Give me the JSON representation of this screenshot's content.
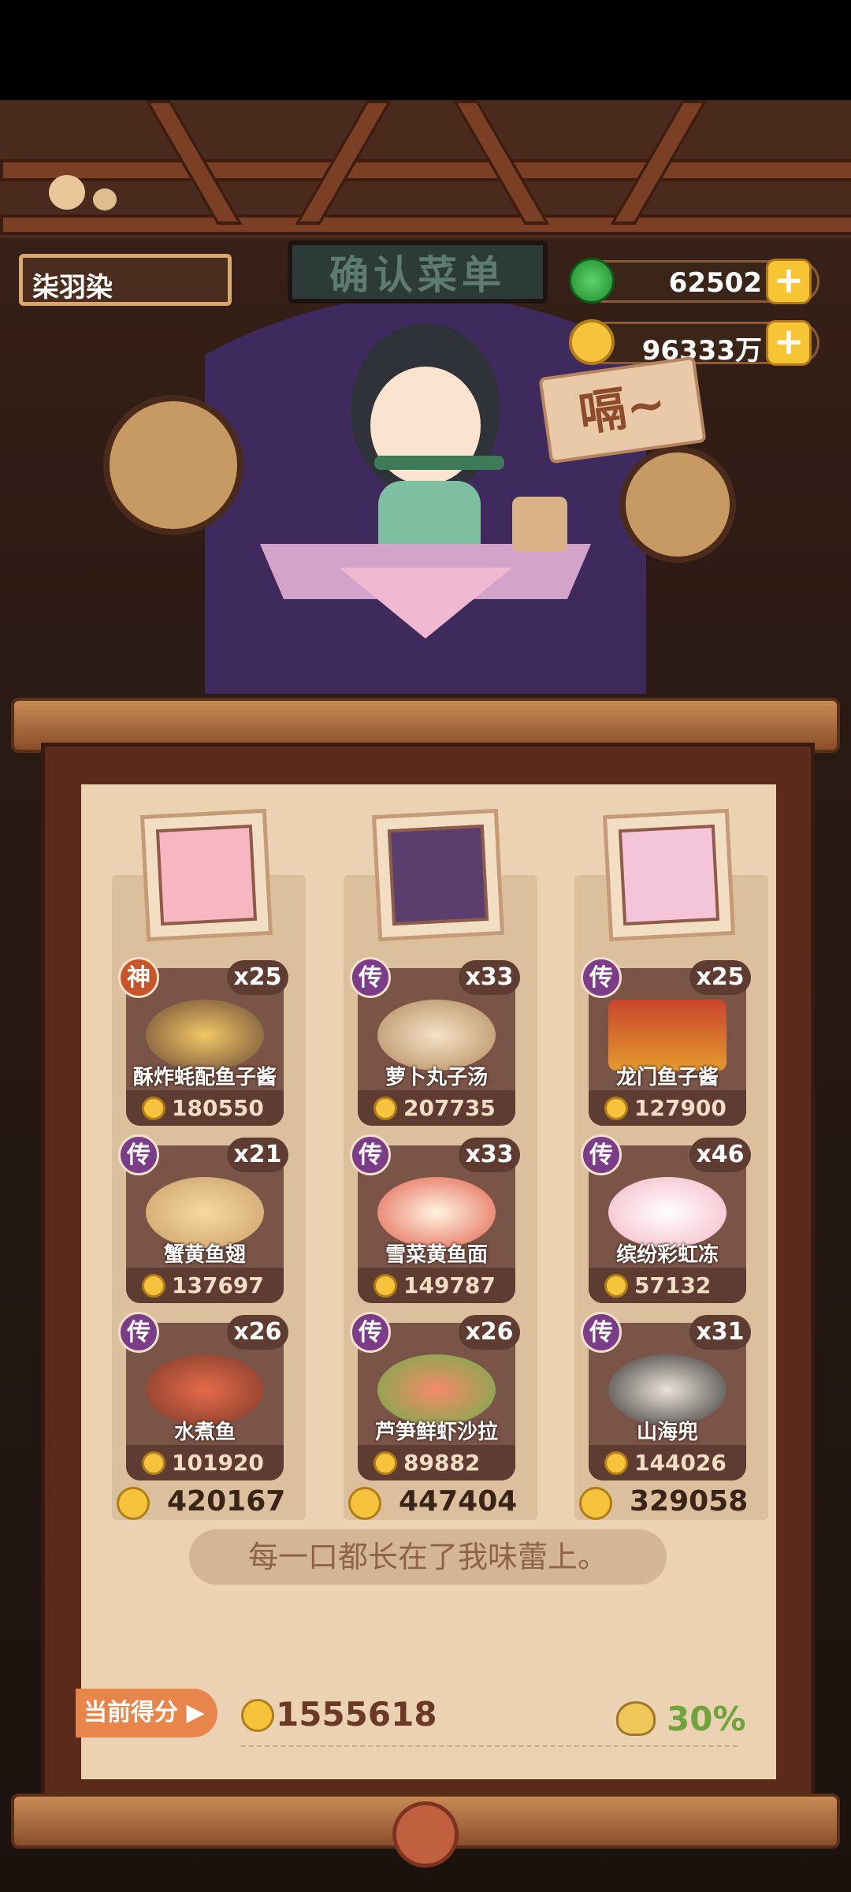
{
  "player": {
    "name": "柒羽染"
  },
  "currency": {
    "jade": "62502",
    "coins": "96333万"
  },
  "sign": "确认菜单",
  "speech": "嗝~",
  "quote": "每一口都长在了我味蕾上。",
  "footer": {
    "score_label": "当前得分",
    "score": "1555618",
    "bonus_pct": "30%"
  },
  "columns": [
    {
      "total": "420167",
      "dishes": [
        {
          "name": "酥炸蚝配鱼子酱",
          "badge": "神",
          "qty": "x25",
          "price": "180550"
        },
        {
          "name": "蟹黄鱼翅",
          "badge": "传",
          "qty": "x21",
          "price": "137697"
        },
        {
          "name": "水煮鱼",
          "badge": "传",
          "qty": "x26",
          "price": "101920"
        }
      ]
    },
    {
      "total": "447404",
      "dishes": [
        {
          "name": "萝卜丸子汤",
          "badge": "传",
          "qty": "x33",
          "price": "207735"
        },
        {
          "name": "雪菜黄鱼面",
          "badge": "传",
          "qty": "x33",
          "price": "149787"
        },
        {
          "name": "芦笋鲜虾沙拉",
          "badge": "传",
          "qty": "x26",
          "price": "89882"
        }
      ]
    },
    {
      "total": "329058",
      "dishes": [
        {
          "name": "龙门鱼子酱",
          "badge": "传",
          "qty": "x25",
          "price": "127900"
        },
        {
          "name": "缤纷彩虹冻",
          "badge": "传",
          "qty": "x46",
          "price": "57132"
        },
        {
          "name": "山海兜",
          "badge": "传",
          "qty": "x31",
          "price": "144026"
        }
      ]
    }
  ]
}
